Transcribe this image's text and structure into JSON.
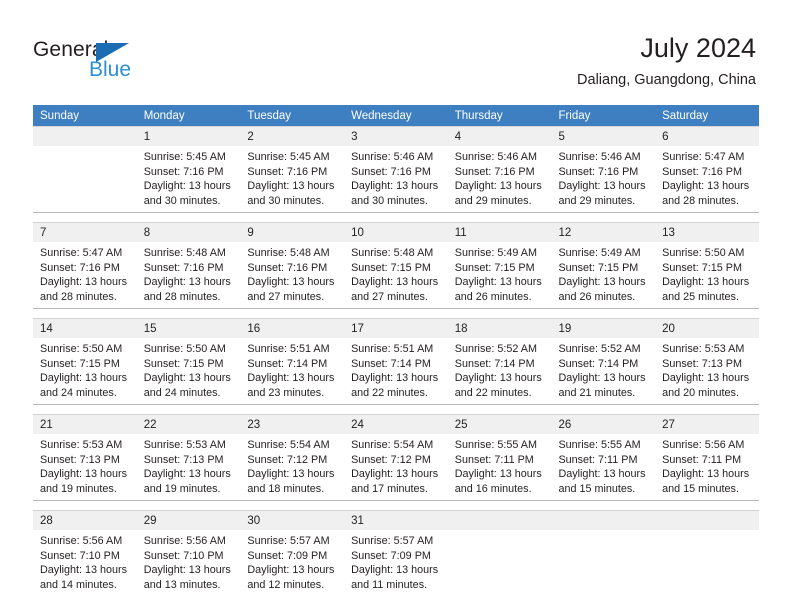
{
  "logo": {
    "word_one": "General",
    "word_two": "Blue",
    "triangle_color": "#1b6cb3",
    "blue_color": "#2f8fd4"
  },
  "header": {
    "title": "July 2024",
    "subtitle": "Daliang, Guangdong, China"
  },
  "theme": {
    "header_row_bg": "#3d7fc1",
    "daynum_bg": "#f0f0f0",
    "cell_bg": "#ffffff",
    "text": "#231f20"
  },
  "weekdays": [
    "Sunday",
    "Monday",
    "Tuesday",
    "Wednesday",
    "Thursday",
    "Friday",
    "Saturday"
  ],
  "weeks": [
    [
      {
        "day": "",
        "sunrise": "",
        "sunset": "",
        "daylight_1": "",
        "daylight_2": ""
      },
      {
        "day": "1",
        "sunrise": "Sunrise: 5:45 AM",
        "sunset": "Sunset: 7:16 PM",
        "daylight_1": "Daylight: 13 hours",
        "daylight_2": "and 30 minutes."
      },
      {
        "day": "2",
        "sunrise": "Sunrise: 5:45 AM",
        "sunset": "Sunset: 7:16 PM",
        "daylight_1": "Daylight: 13 hours",
        "daylight_2": "and 30 minutes."
      },
      {
        "day": "3",
        "sunrise": "Sunrise: 5:46 AM",
        "sunset": "Sunset: 7:16 PM",
        "daylight_1": "Daylight: 13 hours",
        "daylight_2": "and 30 minutes."
      },
      {
        "day": "4",
        "sunrise": "Sunrise: 5:46 AM",
        "sunset": "Sunset: 7:16 PM",
        "daylight_1": "Daylight: 13 hours",
        "daylight_2": "and 29 minutes."
      },
      {
        "day": "5",
        "sunrise": "Sunrise: 5:46 AM",
        "sunset": "Sunset: 7:16 PM",
        "daylight_1": "Daylight: 13 hours",
        "daylight_2": "and 29 minutes."
      },
      {
        "day": "6",
        "sunrise": "Sunrise: 5:47 AM",
        "sunset": "Sunset: 7:16 PM",
        "daylight_1": "Daylight: 13 hours",
        "daylight_2": "and 28 minutes."
      }
    ],
    [
      {
        "day": "7",
        "sunrise": "Sunrise: 5:47 AM",
        "sunset": "Sunset: 7:16 PM",
        "daylight_1": "Daylight: 13 hours",
        "daylight_2": "and 28 minutes."
      },
      {
        "day": "8",
        "sunrise": "Sunrise: 5:48 AM",
        "sunset": "Sunset: 7:16 PM",
        "daylight_1": "Daylight: 13 hours",
        "daylight_2": "and 28 minutes."
      },
      {
        "day": "9",
        "sunrise": "Sunrise: 5:48 AM",
        "sunset": "Sunset: 7:16 PM",
        "daylight_1": "Daylight: 13 hours",
        "daylight_2": "and 27 minutes."
      },
      {
        "day": "10",
        "sunrise": "Sunrise: 5:48 AM",
        "sunset": "Sunset: 7:15 PM",
        "daylight_1": "Daylight: 13 hours",
        "daylight_2": "and 27 minutes."
      },
      {
        "day": "11",
        "sunrise": "Sunrise: 5:49 AM",
        "sunset": "Sunset: 7:15 PM",
        "daylight_1": "Daylight: 13 hours",
        "daylight_2": "and 26 minutes."
      },
      {
        "day": "12",
        "sunrise": "Sunrise: 5:49 AM",
        "sunset": "Sunset: 7:15 PM",
        "daylight_1": "Daylight: 13 hours",
        "daylight_2": "and 26 minutes."
      },
      {
        "day": "13",
        "sunrise": "Sunrise: 5:50 AM",
        "sunset": "Sunset: 7:15 PM",
        "daylight_1": "Daylight: 13 hours",
        "daylight_2": "and 25 minutes."
      }
    ],
    [
      {
        "day": "14",
        "sunrise": "Sunrise: 5:50 AM",
        "sunset": "Sunset: 7:15 PM",
        "daylight_1": "Daylight: 13 hours",
        "daylight_2": "and 24 minutes."
      },
      {
        "day": "15",
        "sunrise": "Sunrise: 5:50 AM",
        "sunset": "Sunset: 7:15 PM",
        "daylight_1": "Daylight: 13 hours",
        "daylight_2": "and 24 minutes."
      },
      {
        "day": "16",
        "sunrise": "Sunrise: 5:51 AM",
        "sunset": "Sunset: 7:14 PM",
        "daylight_1": "Daylight: 13 hours",
        "daylight_2": "and 23 minutes."
      },
      {
        "day": "17",
        "sunrise": "Sunrise: 5:51 AM",
        "sunset": "Sunset: 7:14 PM",
        "daylight_1": "Daylight: 13 hours",
        "daylight_2": "and 22 minutes."
      },
      {
        "day": "18",
        "sunrise": "Sunrise: 5:52 AM",
        "sunset": "Sunset: 7:14 PM",
        "daylight_1": "Daylight: 13 hours",
        "daylight_2": "and 22 minutes."
      },
      {
        "day": "19",
        "sunrise": "Sunrise: 5:52 AM",
        "sunset": "Sunset: 7:14 PM",
        "daylight_1": "Daylight: 13 hours",
        "daylight_2": "and 21 minutes."
      },
      {
        "day": "20",
        "sunrise": "Sunrise: 5:53 AM",
        "sunset": "Sunset: 7:13 PM",
        "daylight_1": "Daylight: 13 hours",
        "daylight_2": "and 20 minutes."
      }
    ],
    [
      {
        "day": "21",
        "sunrise": "Sunrise: 5:53 AM",
        "sunset": "Sunset: 7:13 PM",
        "daylight_1": "Daylight: 13 hours",
        "daylight_2": "and 19 minutes."
      },
      {
        "day": "22",
        "sunrise": "Sunrise: 5:53 AM",
        "sunset": "Sunset: 7:13 PM",
        "daylight_1": "Daylight: 13 hours",
        "daylight_2": "and 19 minutes."
      },
      {
        "day": "23",
        "sunrise": "Sunrise: 5:54 AM",
        "sunset": "Sunset: 7:12 PM",
        "daylight_1": "Daylight: 13 hours",
        "daylight_2": "and 18 minutes."
      },
      {
        "day": "24",
        "sunrise": "Sunrise: 5:54 AM",
        "sunset": "Sunset: 7:12 PM",
        "daylight_1": "Daylight: 13 hours",
        "daylight_2": "and 17 minutes."
      },
      {
        "day": "25",
        "sunrise": "Sunrise: 5:55 AM",
        "sunset": "Sunset: 7:11 PM",
        "daylight_1": "Daylight: 13 hours",
        "daylight_2": "and 16 minutes."
      },
      {
        "day": "26",
        "sunrise": "Sunrise: 5:55 AM",
        "sunset": "Sunset: 7:11 PM",
        "daylight_1": "Daylight: 13 hours",
        "daylight_2": "and 15 minutes."
      },
      {
        "day": "27",
        "sunrise": "Sunrise: 5:56 AM",
        "sunset": "Sunset: 7:11 PM",
        "daylight_1": "Daylight: 13 hours",
        "daylight_2": "and 15 minutes."
      }
    ],
    [
      {
        "day": "28",
        "sunrise": "Sunrise: 5:56 AM",
        "sunset": "Sunset: 7:10 PM",
        "daylight_1": "Daylight: 13 hours",
        "daylight_2": "and 14 minutes."
      },
      {
        "day": "29",
        "sunrise": "Sunrise: 5:56 AM",
        "sunset": "Sunset: 7:10 PM",
        "daylight_1": "Daylight: 13 hours",
        "daylight_2": "and 13 minutes."
      },
      {
        "day": "30",
        "sunrise": "Sunrise: 5:57 AM",
        "sunset": "Sunset: 7:09 PM",
        "daylight_1": "Daylight: 13 hours",
        "daylight_2": "and 12 minutes."
      },
      {
        "day": "31",
        "sunrise": "Sunrise: 5:57 AM",
        "sunset": "Sunset: 7:09 PM",
        "daylight_1": "Daylight: 13 hours",
        "daylight_2": "and 11 minutes."
      },
      {
        "day": "",
        "sunrise": "",
        "sunset": "",
        "daylight_1": "",
        "daylight_2": ""
      },
      {
        "day": "",
        "sunrise": "",
        "sunset": "",
        "daylight_1": "",
        "daylight_2": ""
      },
      {
        "day": "",
        "sunrise": "",
        "sunset": "",
        "daylight_1": "",
        "daylight_2": ""
      }
    ]
  ]
}
